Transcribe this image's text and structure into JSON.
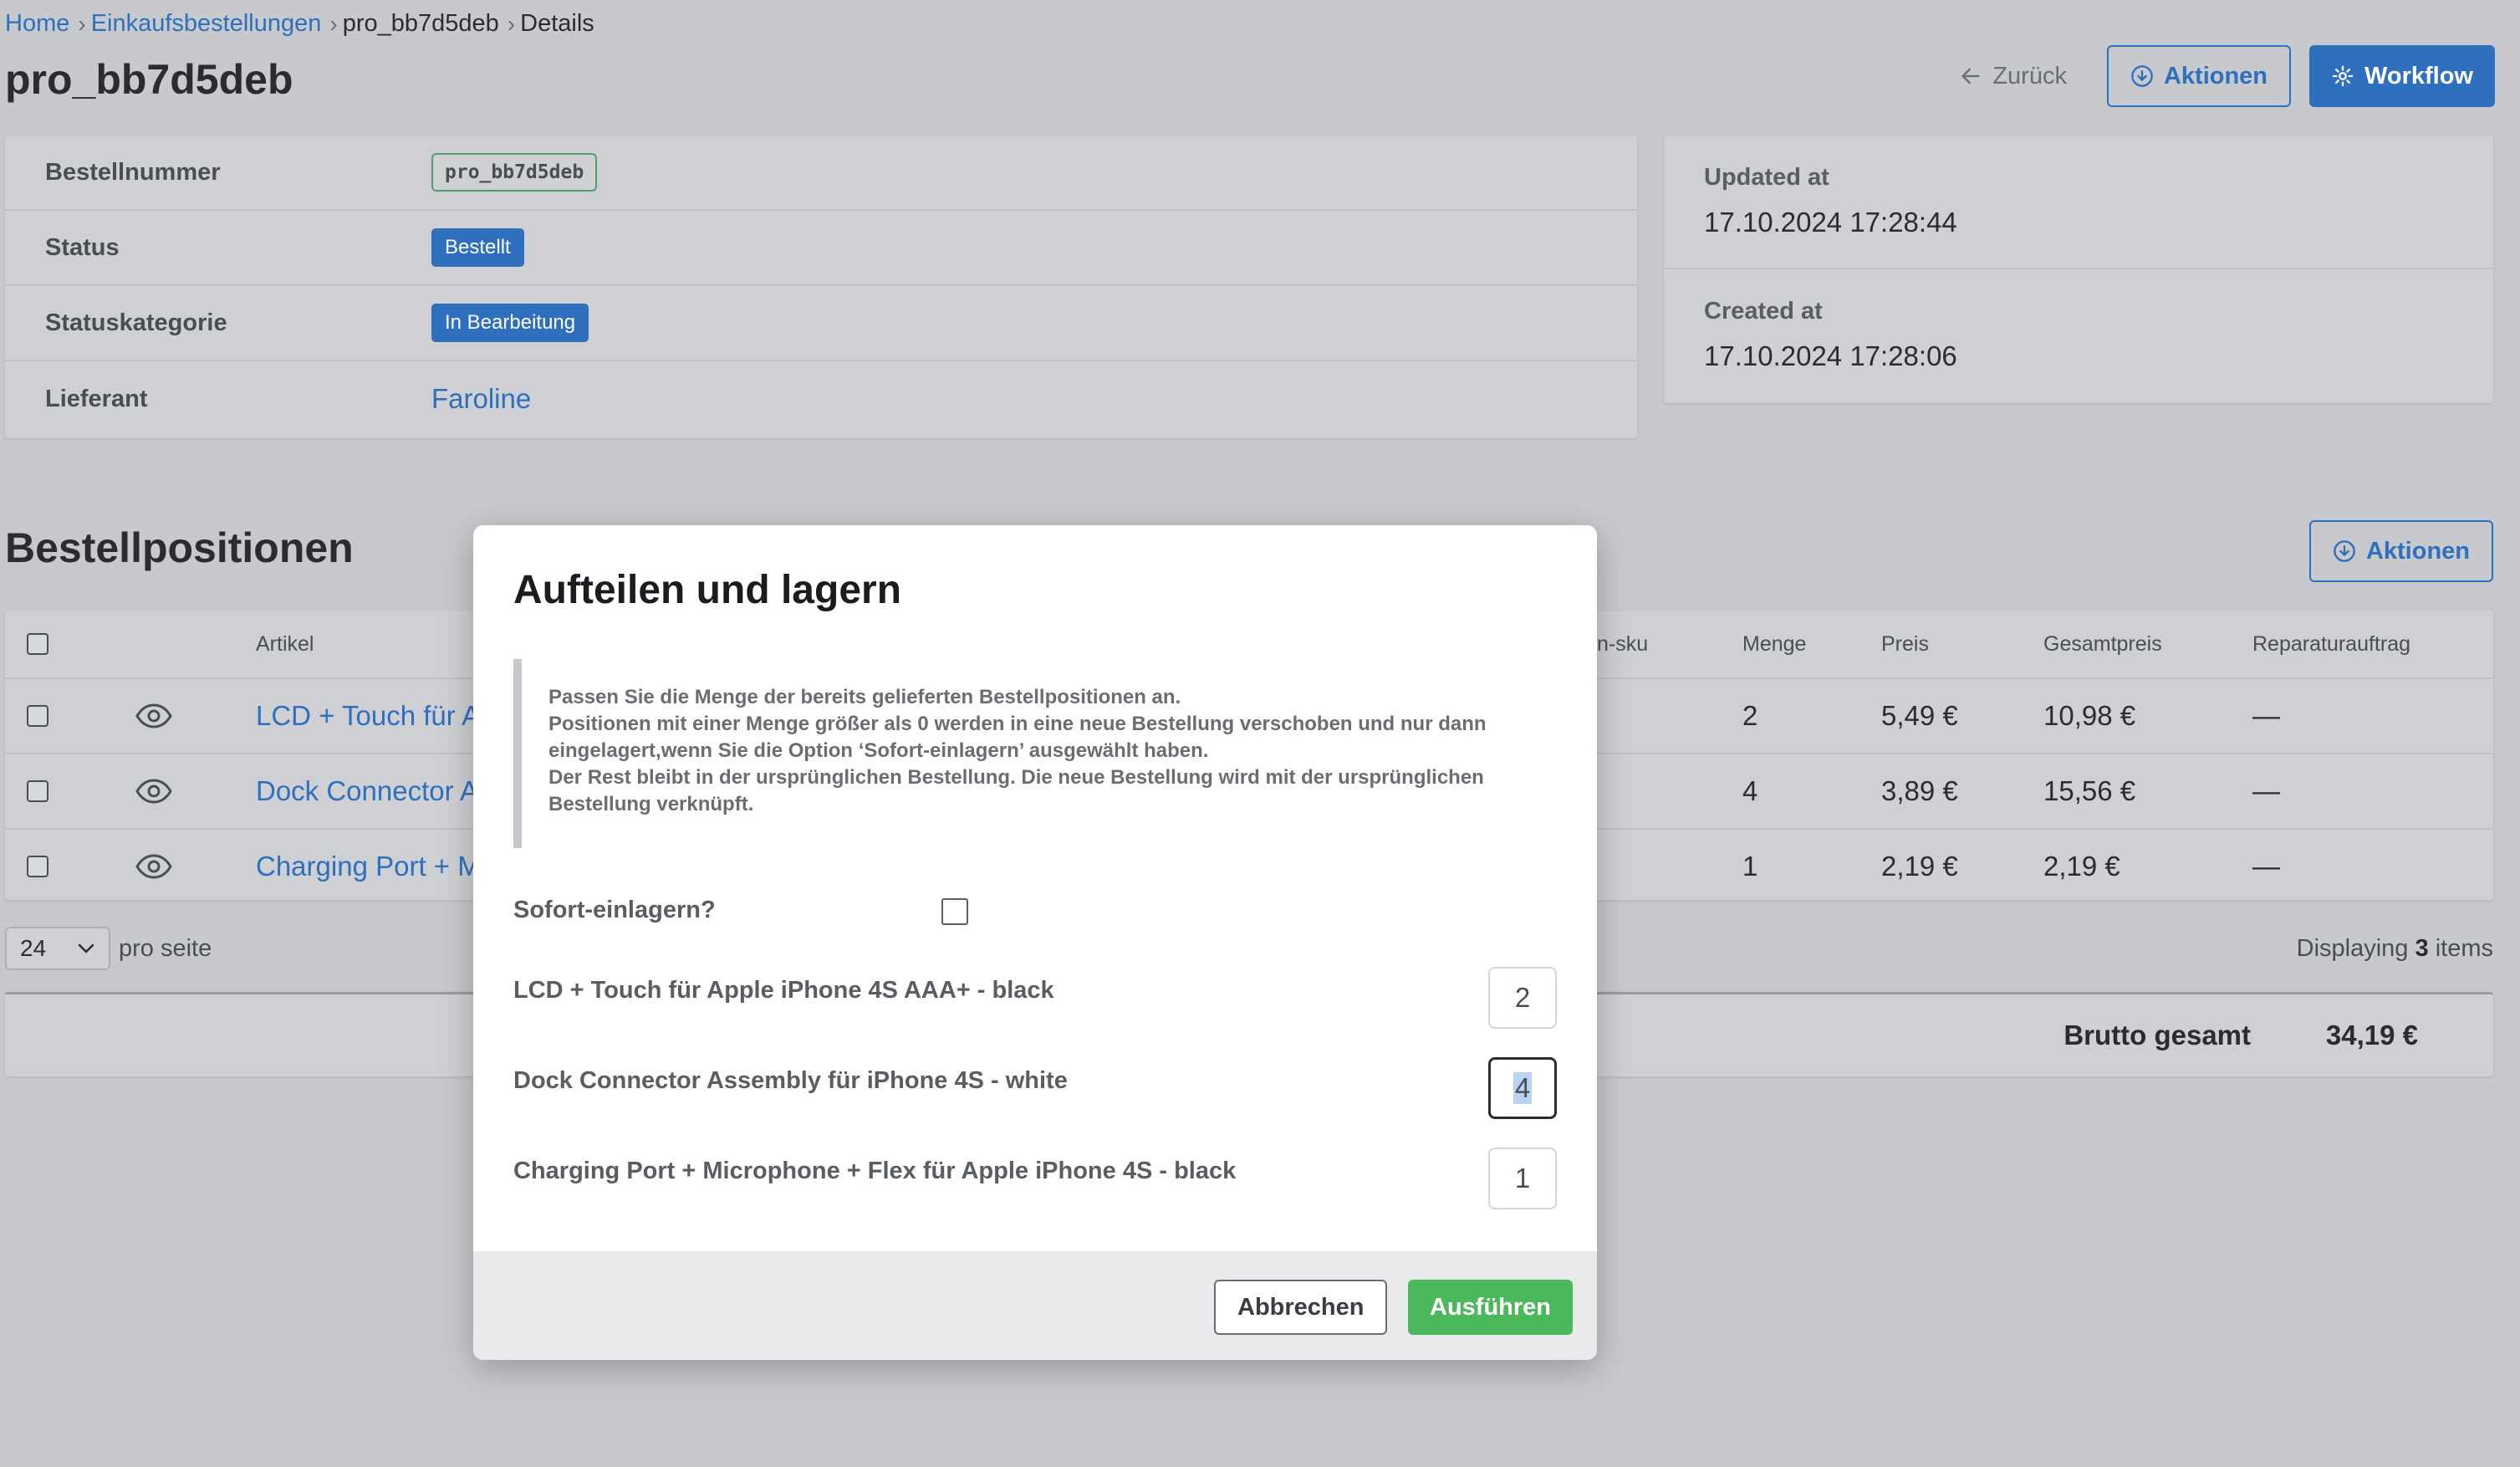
{
  "breadcrumb": {
    "home": "Home",
    "orders": "Einkaufsbestellungen",
    "order_id": "pro_bb7d5deb",
    "details": "Details",
    "separator": "›"
  },
  "page_title": "pro_bb7d5deb",
  "header": {
    "back_label": "Zurück",
    "actions_label": "Aktionen",
    "workflow_label": "Workflow"
  },
  "details": {
    "order_number_label": "Bestellnummer",
    "order_number_value": "pro_bb7d5deb",
    "status_label": "Status",
    "status_value": "Bestellt",
    "status_category_label": "Statuskategorie",
    "status_category_value": "In Bearbeitung",
    "supplier_label": "Lieferant",
    "supplier_value": "Faroline"
  },
  "meta": {
    "updated_label": "Updated at",
    "updated_value": "17.10.2024 17:28:44",
    "created_label": "Created at",
    "created_value": "17.10.2024 17:28:06"
  },
  "positions": {
    "title": "Bestellpositionen",
    "actions_label": "Aktionen",
    "columns": {
      "article": "Artikel",
      "sku": "n-sku",
      "qty": "Menge",
      "price": "Preis",
      "total": "Gesamtpreis",
      "repair": "Reparaturauftrag"
    },
    "rows": [
      {
        "article": "LCD + Touch für A",
        "qty": "2",
        "price": "5,49 €",
        "total": "10,98 €",
        "repair": "—"
      },
      {
        "article": "Dock Connector A",
        "qty": "4",
        "price": "3,89 €",
        "total": "15,56 €",
        "repair": "—"
      },
      {
        "article": "Charging Port + M",
        "qty": "1",
        "price": "2,19 €",
        "total": "2,19 €",
        "repair": "—"
      }
    ],
    "per_page_value": "24",
    "per_page_label": "pro seite",
    "displaying_prefix": "Displaying",
    "displaying_count": "3",
    "displaying_suffix": "items",
    "gross_total_label": "Brutto gesamt",
    "gross_total_value": "34,19 €"
  },
  "modal": {
    "title": "Aufteilen und lagern",
    "notice_lines": [
      "Passen Sie die Menge der bereits gelieferten Bestellpositionen an.",
      "Positionen mit einer Menge größer als 0 werden in eine neue Bestellung verschoben und nur dann",
      "eingelagert,wenn Sie die Option ‘Sofort-einlagern’ ausgewählt haben.",
      "Der Rest bleibt in der ursprünglichen Bestellung. Die neue Bestellung wird mit der ursprünglichen",
      "Bestellung verknüpft."
    ],
    "immediate_store_label": "Sofort-einlagern?",
    "items": [
      {
        "label": "LCD + Touch für Apple iPhone 4S AAA+ - black",
        "qty": "2"
      },
      {
        "label": "Dock Connector Assembly für iPhone 4S - white",
        "qty": "4"
      },
      {
        "label": "Charging Port + Microphone + Flex für Apple iPhone 4S - black",
        "qty": "1"
      }
    ],
    "cancel_label": "Abbrechen",
    "run_label": "Ausführen"
  },
  "colors": {
    "primary": "#2e6fbe",
    "success": "#4cb85c",
    "overlay_bg": "#c8c9cc"
  }
}
